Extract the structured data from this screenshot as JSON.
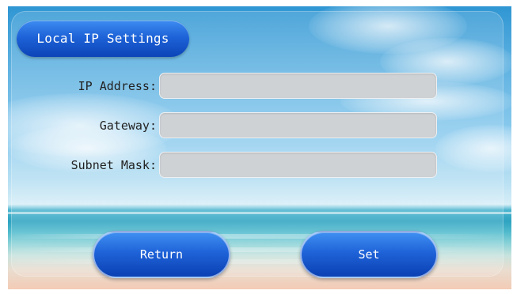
{
  "title": "Local IP Settings",
  "fields": [
    {
      "label": "IP Address:",
      "value": ""
    },
    {
      "label": "Gateway:",
      "value": ""
    },
    {
      "label": "Subnet Mask:",
      "value": ""
    }
  ],
  "buttons": {
    "return_label": "Return",
    "set_label": "Set"
  },
  "colors": {
    "button_blue": "#1e63d8",
    "field_gray": "#cfd2d5"
  }
}
